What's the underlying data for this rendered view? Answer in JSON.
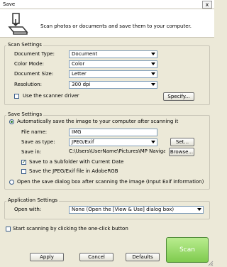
{
  "window": {
    "title": "Save",
    "close_glyph": "x"
  },
  "header": {
    "icon": "scan-to-folder-icon",
    "text": "Scan photos or documents and save them to your computer."
  },
  "scan_settings": {
    "group_label": "Scan Settings",
    "document_type": {
      "label": "Document Type:",
      "value": "Document"
    },
    "color_mode": {
      "label": "Color Mode:",
      "value": "Color"
    },
    "document_size": {
      "label": "Document Size:",
      "value": "Letter"
    },
    "resolution": {
      "label": "Resolution:",
      "value": "300 dpi"
    },
    "use_scanner_driver": {
      "label": "Use the scanner driver",
      "checked": false
    },
    "specify_button": "Specify..."
  },
  "save_settings": {
    "group_label": "Save Settings",
    "auto_save": {
      "label": "Automatically save the image to your computer after scanning it",
      "selected": true
    },
    "file_name": {
      "label": "File name:",
      "value": "IMG"
    },
    "save_as_type": {
      "label": "Save as type:",
      "value": "JPEG/Exif"
    },
    "set_button": "Set...",
    "save_in": {
      "label": "Save in:",
      "value": "C:\\Users\\UserName\\Pictures\\MP Navigatc"
    },
    "browse_button": "Browse...",
    "save_subfolder": {
      "label": "Save to a Subfolder with Current Date",
      "checked": true
    },
    "save_adobergb": {
      "label": "Save the JPEG/Exif file in AdobeRGB",
      "checked": false
    },
    "open_dialog": {
      "label": "Open the save dialog box after scanning the image (Input Exif information)",
      "selected": false
    }
  },
  "application_settings": {
    "group_label": "Application Settings",
    "open_with": {
      "label": "Open with:",
      "value": "None (Open the [View & Use] dialog box)"
    }
  },
  "one_click": {
    "label": "Start scanning by clicking the one-click button",
    "checked": false
  },
  "footer": {
    "apply": "Apply",
    "cancel": "Cancel",
    "defaults": "Defaults",
    "scan": "Scan"
  },
  "colors": {
    "scan_button": "#8fd35f",
    "dialog_bg": "#ece9d8",
    "field_border": "#7f9db9"
  }
}
